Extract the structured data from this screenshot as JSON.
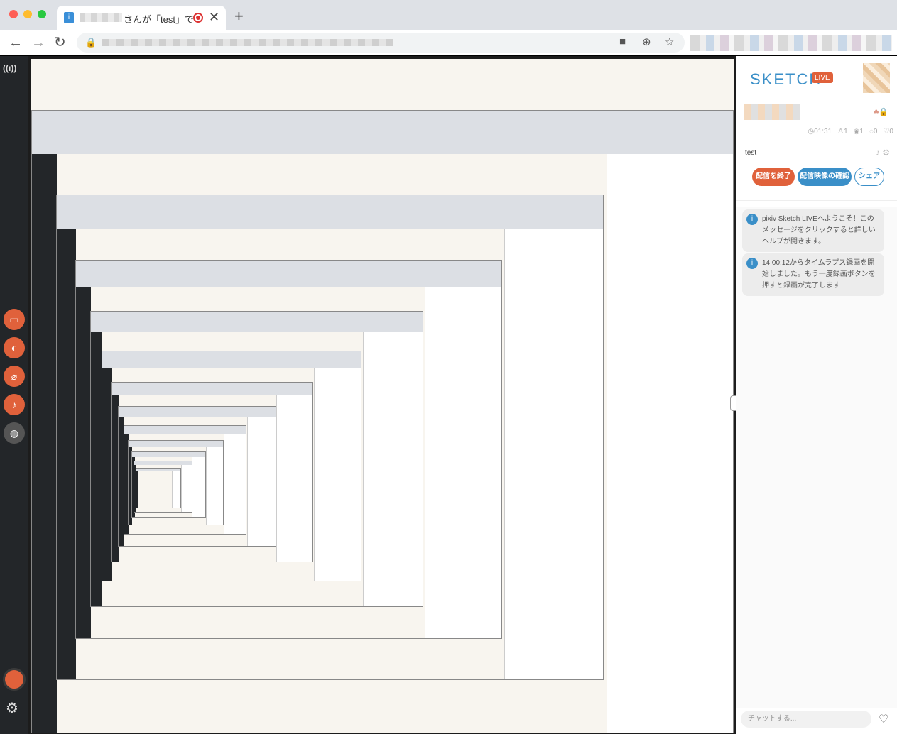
{
  "browser": {
    "tab_title": "さんが「test」で",
    "tab_close": "✕",
    "new_tab": "+",
    "back": "←",
    "forward": "→",
    "reload": "↻",
    "lock": "🔒",
    "camera_icon": "■",
    "zoom_icon": "⊕",
    "star_icon": "☆"
  },
  "rail": {
    "broadcast_label": "((ı))",
    "gear": "⚙"
  },
  "panel": {
    "logo": "SKETCH",
    "live": "LIVE",
    "stats": {
      "time": "◷01:31",
      "viewers": "♙1",
      "views": "◉1",
      "comments": "◌0",
      "hearts": "♡0"
    },
    "stream_title": "test",
    "end_button": "配信を終了",
    "check_button": "配信映像の確認",
    "share_button": "シェア",
    "messages": [
      "pixiv Sketch LIVEへようこそ！このメッセージをクリックすると詳しいヘルプが開きます。",
      "14:00:12からタイムラプス録画を開始しました。もう一度録画ボタンを押すと録画が完了します"
    ],
    "chat_placeholder": "チャットする...",
    "heart": "♡",
    "collapse": "›"
  }
}
